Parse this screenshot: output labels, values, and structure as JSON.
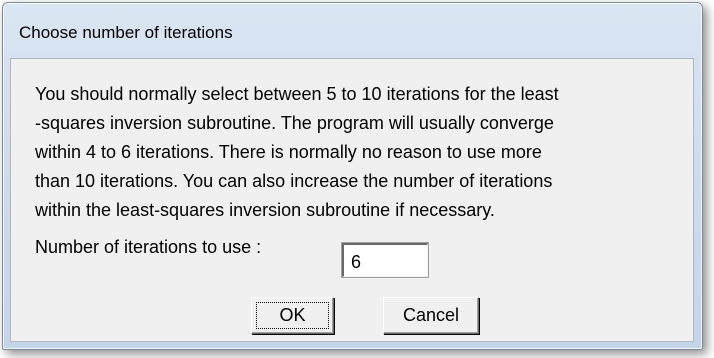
{
  "window": {
    "title": "Choose number of iterations"
  },
  "dialog": {
    "message": "You should normally select between 5 to 10 iterations for the least\n-squares inversion subroutine. The program will usually converge\nwithin 4 to 6 iterations. There is normally no reason to use more\nthan 10 iterations. You can also increase the number of iterations\nwithin the least-squares inversion subroutine if necessary.",
    "iterations_label": "Number of iterations to use :",
    "iterations_value": "6",
    "ok_label": "OK",
    "cancel_label": "Cancel"
  }
}
